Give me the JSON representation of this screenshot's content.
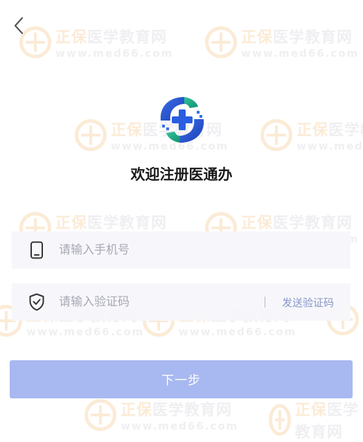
{
  "page": {
    "title": "欢迎注册医通办"
  },
  "form": {
    "phone_placeholder": "请输入手机号",
    "code_placeholder": "请输入验证码",
    "send_code_label": "发送验证码",
    "next_label": "下一步"
  },
  "watermark": {
    "brand_orange": "正保",
    "brand_gray": "医学教育网",
    "url": "www.med66.com"
  },
  "colors": {
    "primary_button": "#a8b8f0",
    "link": "#8a96c8",
    "field_bg": "#f6f6fb",
    "watermark_orange": "#f0a64a"
  },
  "icons": {
    "back": "chevron-left-icon",
    "phone": "phone-icon",
    "shield": "shield-check-icon",
    "logo": "app-logo-icon"
  }
}
